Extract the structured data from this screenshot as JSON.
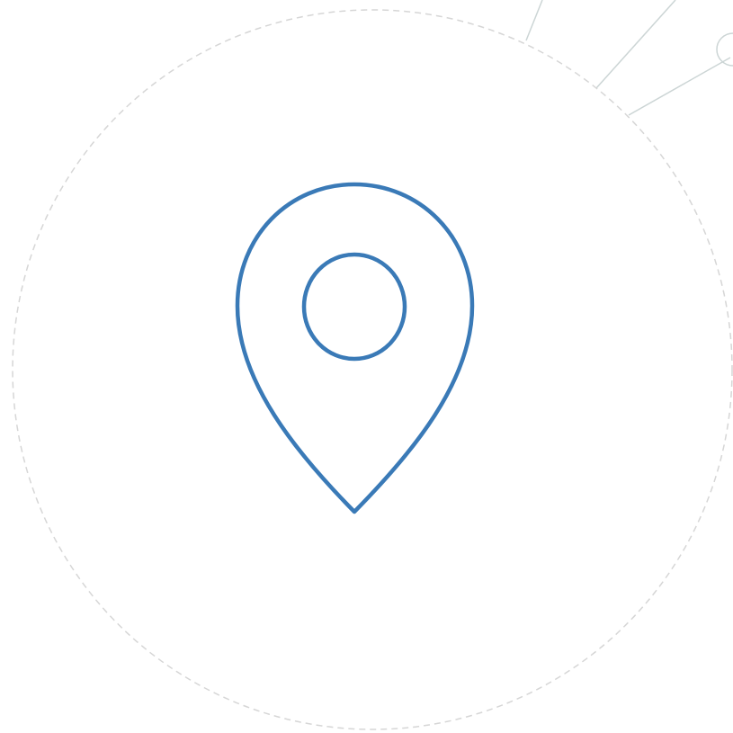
{
  "icon": {
    "name": "location-pin-icon",
    "stroke_color": "#3a7ab7"
  },
  "decor": {
    "dashed_circle_color": "#d6d6d6",
    "ray_color": "#ccd5d5"
  }
}
